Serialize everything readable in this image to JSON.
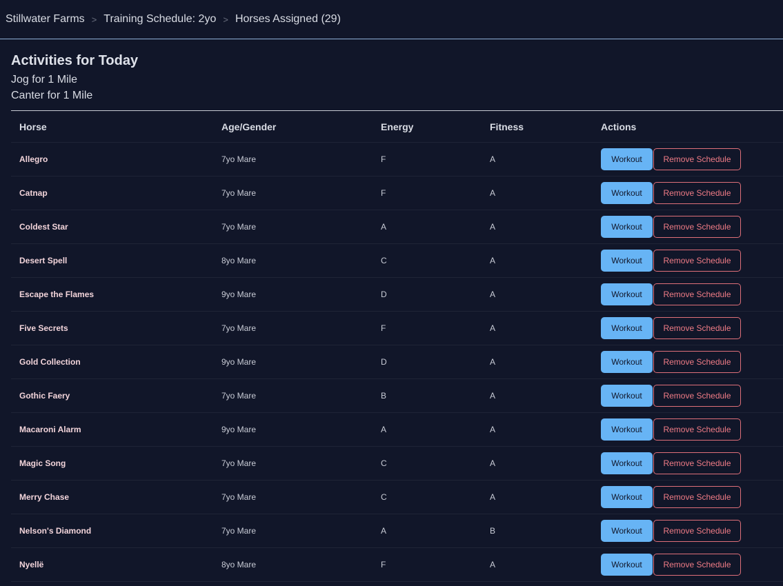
{
  "breadcrumb": [
    "Stillwater Farms",
    "Training Schedule: 2yo",
    "Horses Assigned (29)"
  ],
  "activities": {
    "title": "Activities for Today",
    "items": [
      "Jog for 1 Mile",
      "Canter for 1 Mile"
    ]
  },
  "table": {
    "headers": [
      "Horse",
      "Age/Gender",
      "Energy",
      "Fitness",
      "Actions"
    ],
    "workout_label": "Workout",
    "remove_label": "Remove Schedule",
    "rows": [
      [
        "Allegro",
        "7yo Mare",
        "F",
        "A"
      ],
      [
        "Catnap",
        "7yo Mare",
        "F",
        "A"
      ],
      [
        "Coldest Star",
        "7yo Mare",
        "A",
        "A"
      ],
      [
        "Desert Spell",
        "8yo Mare",
        "C",
        "A"
      ],
      [
        "Escape the Flames",
        "9yo Mare",
        "D",
        "A"
      ],
      [
        "Five Secrets",
        "7yo Mare",
        "F",
        "A"
      ],
      [
        "Gold Collection",
        "9yo Mare",
        "D",
        "A"
      ],
      [
        "Gothic Faery",
        "7yo Mare",
        "B",
        "A"
      ],
      [
        "Macaroni Alarm",
        "9yo Mare",
        "A",
        "A"
      ],
      [
        "Magic Song",
        "7yo Mare",
        "C",
        "A"
      ],
      [
        "Merry Chase",
        "7yo Mare",
        "C",
        "A"
      ],
      [
        "Nelson's Diamond",
        "7yo Mare",
        "A",
        "B"
      ],
      [
        "Nyellë",
        "8yo Mare",
        "F",
        "A"
      ]
    ]
  }
}
